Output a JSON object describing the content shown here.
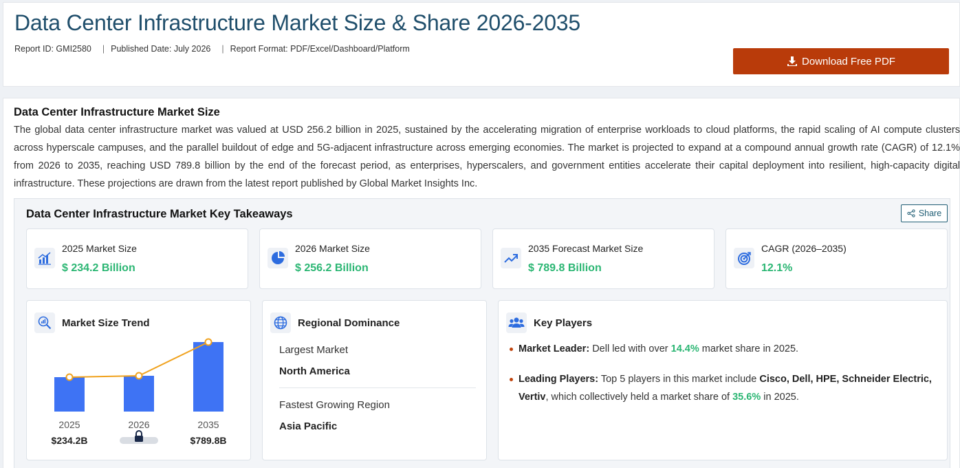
{
  "header": {
    "title": "Data Center Infrastructure Market Size & Share 2026-2035",
    "report_id": "Report ID: GMI2580",
    "published": "Published Date: July 2026",
    "format": "Report Format: PDF/Excel/Dashboard/Platform",
    "separator": "|",
    "download_label": "Download Free PDF",
    "download_color": "#b93b0a"
  },
  "section": {
    "title": "Data Center Infrastructure Market Size",
    "paragraph": "The global data center infrastructure market was valued at USD 256.2 billion in 2025, sustained by the accelerating migration of enterprise workloads to cloud platforms, the rapid scaling of AI compute clusters across hyperscale campuses, and the parallel buildout of edge and 5G-adjacent infrastructure across emerging economies. The market is projected to expand at a compound annual growth rate (CAGR) of 12.1% from 2026 to 2035, reaching USD 789.8 billion by the end of the forecast period, as enterprises, hyperscalers, and government entities accelerate their capital deployment into resilient, high-capacity digital infrastructure. These projections are drawn from the latest report published by Global Market Insights Inc."
  },
  "takeaways": {
    "title": "Data Center Infrastructure Market Key Takeaways",
    "share_label": "Share",
    "stats": [
      {
        "label": "2025 Market Size",
        "value": "$ 234.2 Billion",
        "icon": "bar-chart-icon"
      },
      {
        "label": "2026 Market Size",
        "value": "$ 256.2 Billion",
        "icon": "pie-chart-icon"
      },
      {
        "label": "2035 Forecast Market Size",
        "value": "$ 789.8 Billion",
        "icon": "trend-up-icon"
      },
      {
        "label": "CAGR (2026–2035)",
        "value": "12.1%",
        "icon": "target-icon"
      }
    ],
    "accent_green": "#2bb673"
  },
  "trend": {
    "title": "Market Size Trend",
    "icon": "magnifier-chart-icon",
    "locked_icon": "lock-icon"
  },
  "chart_data": {
    "type": "bar",
    "categories": [
      "2025",
      "2026",
      "2035"
    ],
    "values": [
      234.2,
      256.2,
      789.8
    ],
    "value_labels": [
      "$234.2B",
      "",
      "$789.8B"
    ],
    "locked": [
      false,
      true,
      false
    ],
    "overlay": "line",
    "bar_color": "#3e73f4",
    "line_color": "#f0a21e"
  },
  "regional": {
    "title": "Regional Dominance",
    "icon": "globe-icon",
    "largest_label": "Largest Market",
    "largest_value": "North America",
    "fastest_label": "Fastest Growing Region",
    "fastest_value": "Asia Pacific"
  },
  "players": {
    "title": "Key Players",
    "icon": "users-icon",
    "leader_label": "Market Leader:",
    "leader_pre": "Dell led with over",
    "leader_share": "14.4%",
    "leader_post": "market share in 2025.",
    "leading_label": "Leading Players:",
    "leading_pre": "Top 5 players in this market include",
    "leading_names": "Cisco, Dell, HPE, Schneider Electric, Vertiv",
    "leading_mid": ", which collectively held a market share of",
    "leading_share": "35.6%",
    "leading_post": "in 2025."
  }
}
